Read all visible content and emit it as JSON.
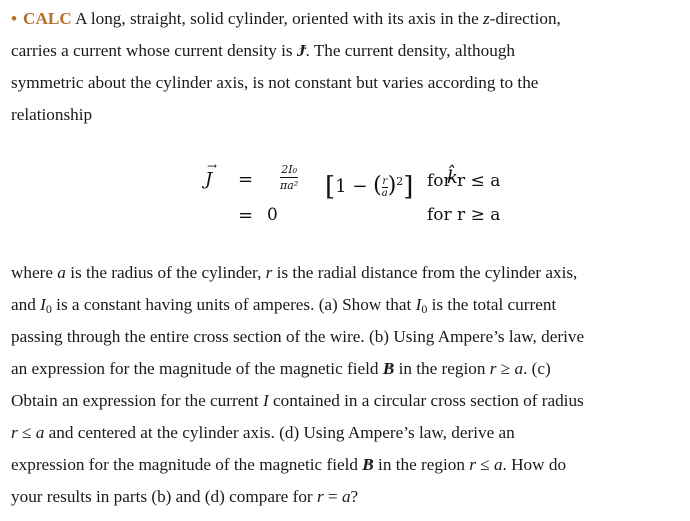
{
  "problem": {
    "bullet": "•",
    "tag": "CALC",
    "intro_lines": [
      [
        " A long, straight, solid cylinder, oriented with its axis in the ",
        {
          "math": "z"
        },
        "-direction,"
      ],
      [
        "carries a current whose current density is ",
        {
          "vec": "J"
        },
        ". The current density, although"
      ],
      [
        "symmetric about the cylinder axis, is not constant but varies according to the"
      ],
      [
        "relationship"
      ]
    ],
    "equation": {
      "row1": {
        "lhs": "J",
        "relation": "=",
        "coef_num": "2I₀",
        "coef_den": "πa²",
        "bracket_expr": "1 − (r/a)²",
        "unit_vector": "k̂",
        "condition": "for r ≤ a"
      },
      "row2": {
        "relation": "=",
        "value": "0",
        "condition": "for r ≥ a"
      }
    },
    "body_lines": [
      "where a is the radius of the cylinder, r is the radial distance from the cylinder axis,",
      "and I₀ is a constant having units of amperes. (a) Show that I₀ is the total current",
      "passing through the entire cross section of the wire. (b) Using Ampere's law, derive",
      "an expression for the magnitude of the magnetic field B in the region r ≥ a. (c)",
      "Obtain an expression for the current I contained in a circular cross section of radius",
      "r ≤ a and centered at the cylinder axis. (d) Using Ampere's law, derive an",
      "expression for the magnitude of the magnetic field B in the region r ≤ a. How do",
      "your results in parts (b) and (d) compare for r = a?"
    ],
    "t": {
      "l1a": " A long, straight, solid cylinder, oriented with its axis in the ",
      "z": "z",
      "l1b": "-direction,",
      "l2a": "carries a current whose current density is ",
      "J": "J",
      "l2b": ". The current density, although",
      "l3": "symmetric about the cylinder axis, is not constant but varies according to the",
      "l4": "relationship",
      "b1a": "where ",
      "a": "a",
      "b1b": " is the radius of the cylinder, ",
      "r": "r",
      "b1c": " is the radial distance from the cylinder axis,",
      "b2a": "and ",
      "I": "I",
      "zero": "0",
      "b2b": " is a constant having units of amperes. (a) Show that ",
      "b2c": " is the total current",
      "b3": "passing through the entire cross section of the wire. (b) Using Ampere’s law, derive",
      "b4a": "an expression for the magnitude of the magnetic field ",
      "B": "B",
      "b4b": " in the region ",
      "ge": " ≥ ",
      "b4c": ". (c)",
      "b5a": "Obtain an expression for the current ",
      "b5b": " contained in a circular cross section of radius",
      "le": " ≤ ",
      "b6": " and centered at the cylinder axis. (d) Using Ampere’s law, derive an",
      "b7a": "expression for the magnitude of the magnetic field ",
      "b7b": " in the region ",
      "b7c": ". How do",
      "b8a": "your results in parts (b) and (d) compare for ",
      "eq": " = ",
      "b8b": "?"
    }
  }
}
